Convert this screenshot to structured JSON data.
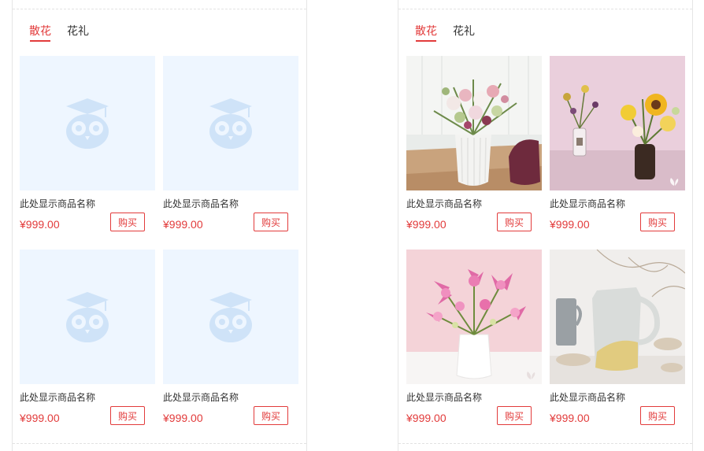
{
  "panels": [
    {
      "tabs": [
        {
          "label": "散花",
          "active": true
        },
        {
          "label": "花礼",
          "active": false
        }
      ],
      "products": [
        {
          "name": "此处显示商品名称",
          "price": "¥999.00",
          "buy_label": "购买",
          "image": "placeholder-owl"
        },
        {
          "name": "此处显示商品名称",
          "price": "¥999.00",
          "buy_label": "购买",
          "image": "placeholder-owl"
        },
        {
          "name": "此处显示商品名称",
          "price": "¥999.00",
          "buy_label": "购买",
          "image": "placeholder-owl"
        },
        {
          "name": "此处显示商品名称",
          "price": "¥999.00",
          "buy_label": "购买",
          "image": "placeholder-owl"
        }
      ]
    },
    {
      "tabs": [
        {
          "label": "散花",
          "active": true
        },
        {
          "label": "花礼",
          "active": false
        }
      ],
      "products": [
        {
          "name": "此处显示商品名称",
          "price": "¥999.00",
          "buy_label": "购买",
          "image": "flower-bouquet-white-vase"
        },
        {
          "name": "此处显示商品名称",
          "price": "¥999.00",
          "buy_label": "购买",
          "image": "sunflower-bouquet-pink-wall"
        },
        {
          "name": "此处显示商品名称",
          "price": "¥999.00",
          "buy_label": "购买",
          "image": "pink-lilies-white-vase"
        },
        {
          "name": "此处显示商品名称",
          "price": "¥999.00",
          "buy_label": "购买",
          "image": "ceramic-jug-dried-grass"
        }
      ]
    }
  ],
  "colors": {
    "accent": "#e23b3b",
    "placeholder_bg": "#eef6ff",
    "placeholder_icon": "#cfe3f8"
  }
}
